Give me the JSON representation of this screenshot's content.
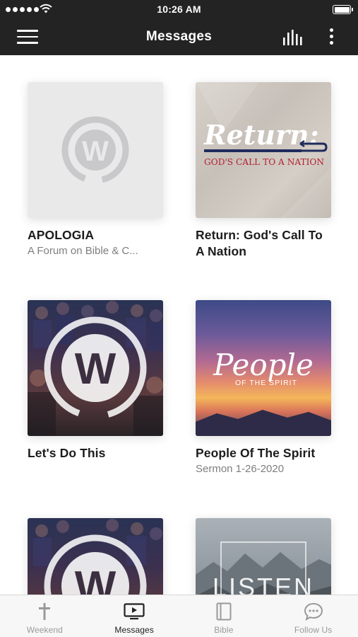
{
  "status_bar": {
    "time": "10:26 AM",
    "signal_icon": "signal-dots-icon",
    "wifi_icon": "wifi-icon",
    "battery_icon": "battery-icon",
    "battery_level": 1.0
  },
  "nav": {
    "title": "Messages",
    "menu_icon": "hamburger-menu-icon",
    "audio_icon": "audio-bars-icon",
    "more_icon": "more-vertical-icon"
  },
  "series": [
    {
      "title": "APOLOGIA",
      "subtitle": "A Forum on Bible & C..."
    },
    {
      "title": "Return: God's Call To A Nation",
      "subtitle": "",
      "artwork_title": "Return:",
      "artwork_subtitle": "GOD'S CALL TO A NATION"
    },
    {
      "title": "Let's Do This",
      "subtitle": ""
    },
    {
      "title": "People Of The Spirit",
      "subtitle": "Sermon 1-26-2020",
      "artwork_title": "People",
      "artwork_subtitle": "OF THE SPIRIT"
    },
    {
      "title": "",
      "subtitle": ""
    },
    {
      "title": "",
      "subtitle": "",
      "artwork_title": "LISTEN"
    }
  ],
  "tabs": [
    {
      "label": "Weekend",
      "icon": "cross-icon",
      "active": false
    },
    {
      "label": "Messages",
      "icon": "tv-play-icon",
      "active": true
    },
    {
      "label": "Bible",
      "icon": "book-icon",
      "active": false
    },
    {
      "label": "Follow Us",
      "icon": "chat-bubble-icon",
      "active": false
    }
  ],
  "colors": {
    "bar_background": "#232323",
    "tab_active": "#222222",
    "tab_inactive": "#999999",
    "return_accent": "#b2202e",
    "return_navy": "#1f2b5c"
  }
}
